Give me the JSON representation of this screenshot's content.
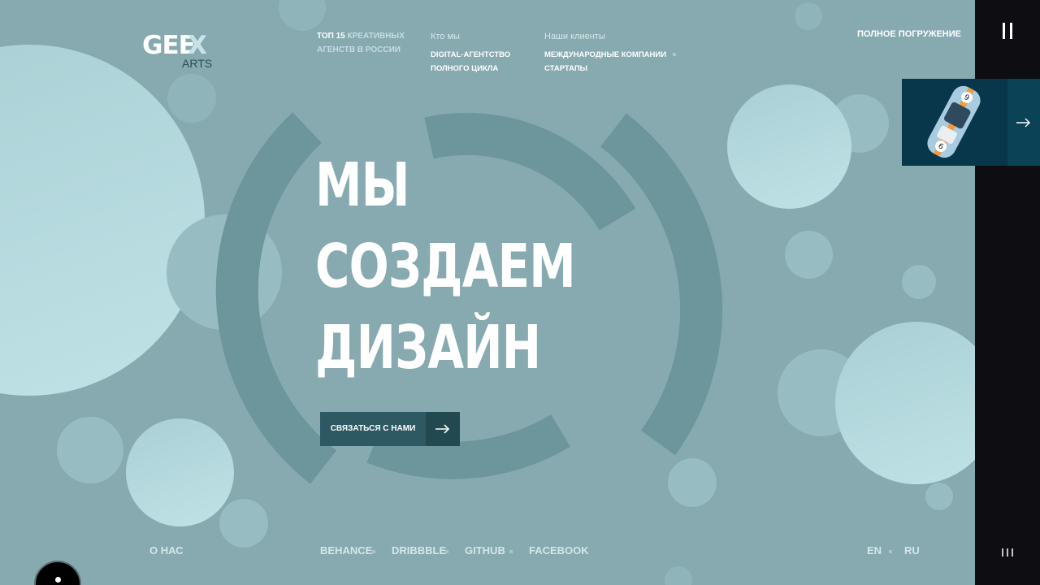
{
  "logo": {
    "main": "GEE",
    "x": "X",
    "sub": "ARTS"
  },
  "tagline": {
    "line1_hi": "ТОП 15",
    "line1_rest": " КРЕАТИВНЫХ",
    "line2": "АГЕНСТВ В РОССИИ"
  },
  "who": {
    "heading": "Кто мы",
    "line1": "DIGITAL-АГЕНТСТВО",
    "line2": "ПОЛНОГО ЦИКЛА"
  },
  "clients": {
    "heading": "Наши клиенты",
    "line1": "МЕЖДУНАРОДНЫЕ КОМПАНИИ",
    "line2": "СТАРТАПЫ"
  },
  "immersion": "ПОЛНОЕ ПОГРУЖЕНИЕ",
  "hero": {
    "line1": "МЫ",
    "line2": "СОЗДАЕМ",
    "line3": "ДИЗАЙН"
  },
  "cta": {
    "label": "СВЯЗАТЬСЯ С НАМИ"
  },
  "footer": {
    "about": "О НАС",
    "social": [
      "BEHANCE",
      "DRIBBBLE",
      "GITHUB",
      "FACEBOOK"
    ],
    "langs": [
      "EN",
      "RU"
    ]
  },
  "colors": {
    "background": "#86aab0",
    "sidebar": "#0d0d12",
    "button": "#2e5962",
    "card": "#08364a",
    "accent": "#f39a3a"
  },
  "icons": {
    "cta": "arrow-right-icon",
    "card": "arrow-right-icon",
    "pause": "pause-icon",
    "audio": "audio-bars-icon"
  }
}
